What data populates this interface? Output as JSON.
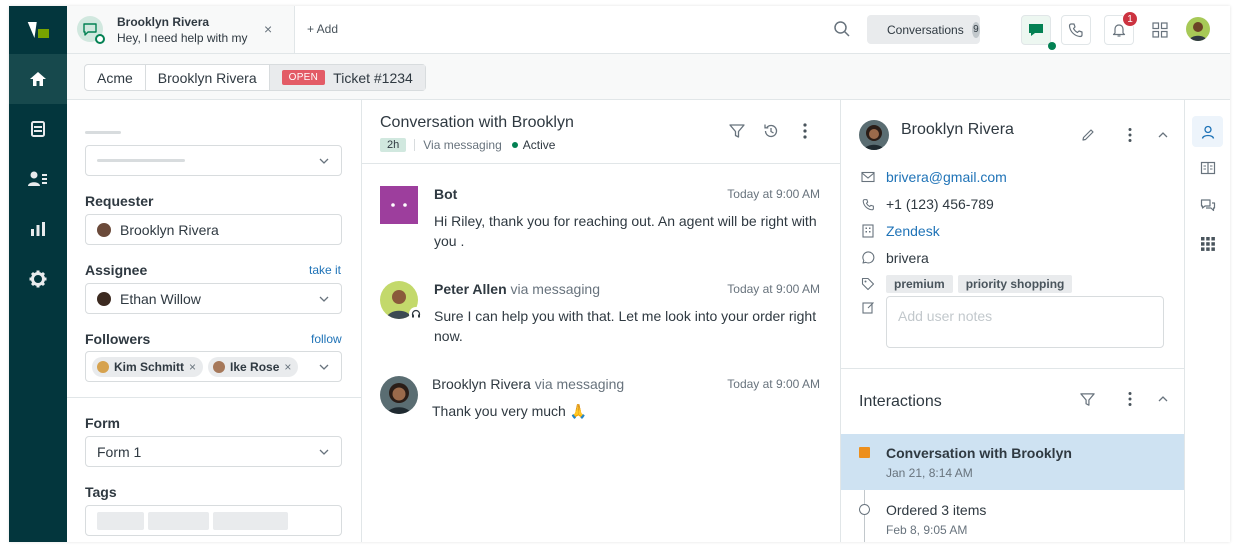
{
  "colors": {
    "rail_bg": "#03363d",
    "rail_active": "#17494d",
    "brand_green": "#78a300",
    "status_open": "#e35b66",
    "link_blue": "#1f73b7",
    "online_green": "#038153",
    "bot_purple": "#9d3e9d",
    "selected_row": "#cee2f2",
    "notification_red": "#cc3340"
  },
  "nav": {
    "items": [
      {
        "name": "home",
        "icon": "home-icon",
        "active": true
      },
      {
        "name": "views",
        "icon": "stack-icon",
        "active": false
      },
      {
        "name": "customers",
        "icon": "users-list-icon",
        "active": false
      },
      {
        "name": "reports",
        "icon": "bar-chart-icon",
        "active": false
      },
      {
        "name": "admin",
        "icon": "gear-icon",
        "active": false
      }
    ]
  },
  "topbar": {
    "tab": {
      "name": "Brooklyn Rivera",
      "preview": "Hey, I need help with my",
      "close": "×"
    },
    "add_label": "+ Add",
    "conversations_label": "Conversations",
    "conversations_count": "9",
    "notification_count": "1"
  },
  "breadcrumb": {
    "org": "Acme",
    "requester": "Brooklyn Rivera",
    "status": "OPEN",
    "ticket": "Ticket #1234"
  },
  "properties": {
    "requester_label": "Requester",
    "requester_value": "Brooklyn Rivera",
    "assignee_label": "Assignee",
    "assignee_link": "take it",
    "assignee_value": "Ethan Willow",
    "followers_label": "Followers",
    "followers_link": "follow",
    "followers": [
      "Kim Schmitt",
      "Ike Rose"
    ],
    "form_label": "Form",
    "form_value": "Form 1",
    "tags_label": "Tags"
  },
  "conversation": {
    "title": "Conversation with Brooklyn",
    "age": "2h",
    "channel": "Via messaging",
    "state": "Active",
    "messages": [
      {
        "author": "Bot",
        "via": "",
        "time": "Today at 9:00 AM",
        "text": "Hi Riley, thank you for reaching out. An agent will be right with you ."
      },
      {
        "author": "Peter Allen",
        "via": "via messaging",
        "time": "Today at 9:00 AM",
        "text": "Sure I can help you with that. Let me look into your order right now."
      },
      {
        "author": "Brooklyn Rivera",
        "via": "via messaging",
        "time": "Today at 9:00 AM",
        "text": "Thank you very much 🙏"
      }
    ]
  },
  "customer": {
    "name": "Brooklyn Rivera",
    "email": "brivera@gmail.com",
    "phone": "+1 (123) 456-789",
    "organization": "Zendesk",
    "whatsapp": "brivera",
    "tags": [
      "premium",
      "priority shopping"
    ],
    "notes_placeholder": "Add user notes"
  },
  "interactions": {
    "title": "Interactions",
    "items": [
      {
        "title": "Conversation with Brooklyn",
        "date": "Jan 21, 8:14 AM",
        "selected": true
      },
      {
        "title": "Ordered 3 items",
        "date": "Feb 8, 9:05 AM",
        "selected": false
      }
    ]
  },
  "apps_rail": {
    "items": [
      "user-icon",
      "knowledge-icon",
      "chat-bubbles-icon",
      "apps-grid-icon"
    ]
  }
}
